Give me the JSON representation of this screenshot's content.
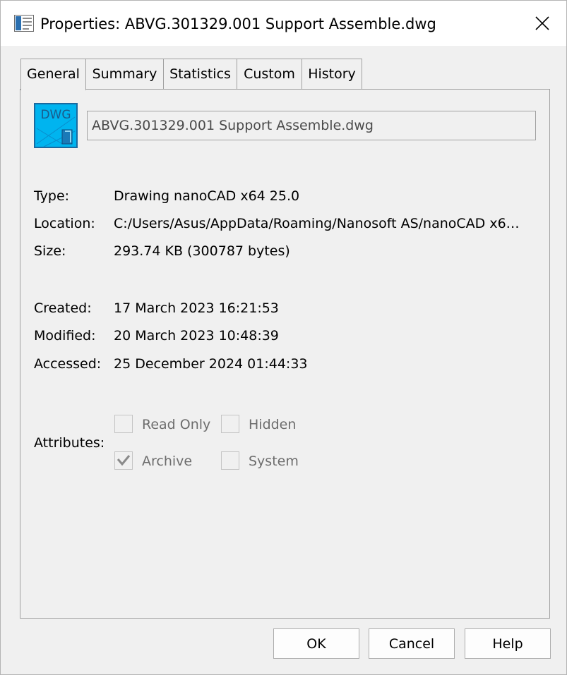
{
  "window": {
    "title": "Properties: ABVG.301329.001 Support Assemble.dwg",
    "title_icon": "properties-window-icon",
    "close_icon": "close-icon"
  },
  "tabs": [
    {
      "label": "General",
      "active": true
    },
    {
      "label": "Summary",
      "active": false
    },
    {
      "label": "Statistics",
      "active": false
    },
    {
      "label": "Custom",
      "active": false
    },
    {
      "label": "History",
      "active": false
    }
  ],
  "general": {
    "file_icon_text": "DWG",
    "file_name": "ABVG.301329.001 Support Assemble.dwg",
    "info": {
      "type_label": "Type:",
      "type_value": "Drawing nanoCAD x64 25.0",
      "location_label": "Location:",
      "location_value": "C:/Users/Asus/AppData/Roaming/Nanosoft AS/nanoCAD x6…",
      "size_label": "Size:",
      "size_value": "293.74 KB (300787 bytes)"
    },
    "dates": {
      "created_label": "Created:",
      "created_value": "17 March 2023 16:21:53",
      "modified_label": "Modified:",
      "modified_value": "20 March 2023 10:48:39",
      "accessed_label": "Accessed:",
      "accessed_value": "25 December 2024 01:44:33"
    },
    "attributes": {
      "label": "Attributes:",
      "read_only": {
        "label": "Read Only",
        "checked": false
      },
      "hidden": {
        "label": "Hidden",
        "checked": false
      },
      "archive": {
        "label": "Archive",
        "checked": true
      },
      "system": {
        "label": "System",
        "checked": false
      }
    }
  },
  "buttons": {
    "ok": "OK",
    "cancel": "Cancel",
    "help": "Help"
  },
  "colors": {
    "dwg_icon_fill": "#00b4ef",
    "dwg_icon_text": "#1a5a8a",
    "disabled_text": "#6d6d6d"
  }
}
